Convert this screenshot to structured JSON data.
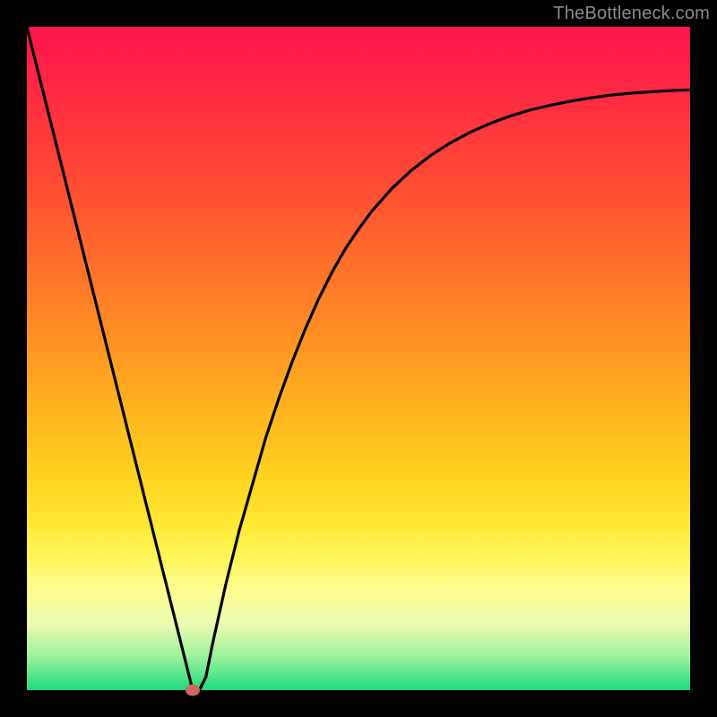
{
  "watermark": "TheBottleneck.com",
  "chart_data": {
    "type": "line",
    "title": "",
    "xlabel": "",
    "ylabel": "",
    "xlim": [
      0,
      100
    ],
    "ylim": [
      0,
      100
    ],
    "grid": false,
    "legend": false,
    "x": [
      0,
      2,
      4,
      6,
      8,
      10,
      12,
      14,
      16,
      18,
      20,
      22,
      24,
      25,
      26,
      27,
      28,
      30,
      32,
      34,
      36,
      38,
      40,
      42,
      44,
      46,
      48,
      50,
      52,
      55,
      58,
      61,
      64,
      67,
      70,
      73,
      76,
      79,
      82,
      85,
      88,
      91,
      94,
      97,
      100
    ],
    "values": [
      100,
      92,
      84,
      76,
      68,
      60,
      52,
      44,
      36,
      28,
      20,
      12,
      4,
      0,
      0,
      2,
      7,
      16,
      24,
      31,
      38,
      44,
      49.5,
      54.5,
      59,
      63,
      66.5,
      69.5,
      72.2,
      75.6,
      78.4,
      80.7,
      82.6,
      84.2,
      85.5,
      86.6,
      87.5,
      88.2,
      88.8,
      89.3,
      89.7,
      90.0,
      90.2,
      90.4,
      90.5
    ],
    "marker": {
      "x": 25,
      "y": 0,
      "color": "#cc6a5f"
    },
    "background_gradient": {
      "top": "#ff1450",
      "mid": "#ffd31f",
      "bottom": "#1bdc7f"
    }
  }
}
